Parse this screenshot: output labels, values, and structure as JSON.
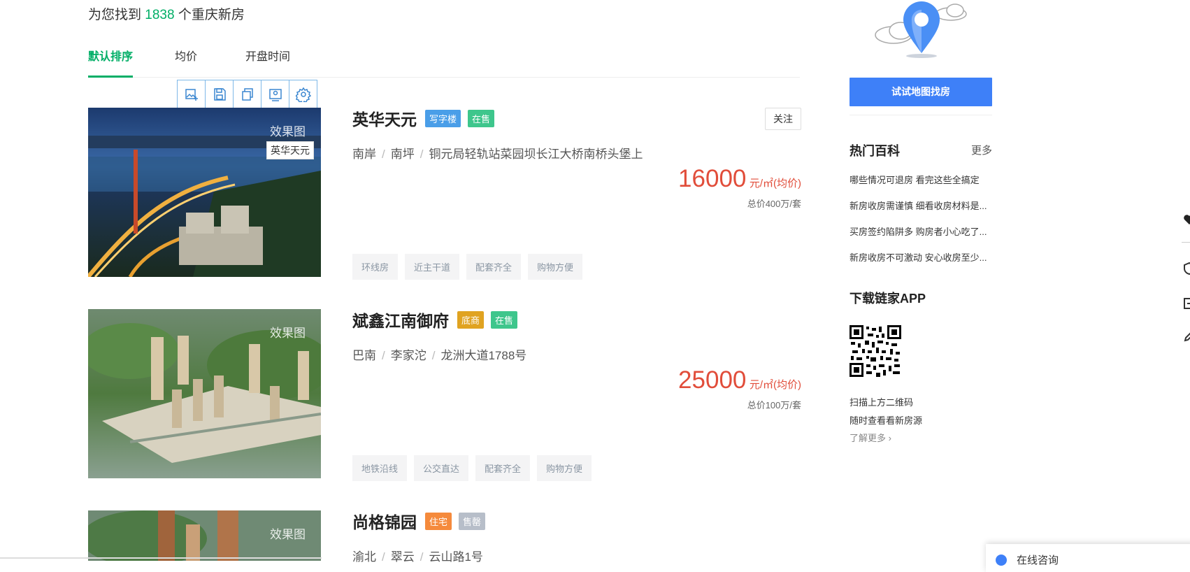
{
  "header": {
    "prefix": "为您找到",
    "count": "1838",
    "suffix": "个重庆新房"
  },
  "sort_tabs": [
    {
      "label": "默认排序",
      "active": true
    },
    {
      "label": "均价",
      "active": false
    },
    {
      "label": "开盘时间",
      "active": false
    }
  ],
  "image_toolbar": [
    "add-image-icon",
    "save-icon",
    "copy-icon",
    "image-edit-icon",
    "gear-icon"
  ],
  "listings": [
    {
      "img_label": "效果图",
      "img_name": "英华天元",
      "title": "英华天元",
      "tags": [
        {
          "text": "写字楼",
          "color": "#4a9ee8"
        },
        {
          "text": "在售",
          "color": "#3ec68c"
        }
      ],
      "follow": "关注",
      "loc": [
        "南岸",
        "南坪",
        "铜元局轻轨站菜园坝长江大桥南桥头堡上"
      ],
      "price": "16000",
      "unit": "元/㎡(均价)",
      "total": "总价400万/套",
      "features": [
        "环线房",
        "近主干道",
        "配套齐全",
        "购物方便"
      ]
    },
    {
      "img_label": "效果图",
      "title": "斌鑫江南御府",
      "tags": [
        {
          "text": "底商",
          "color": "#e0a321"
        },
        {
          "text": "在售",
          "color": "#3ec68c"
        }
      ],
      "loc": [
        "巴南",
        "李家沱",
        "龙洲大道1788号"
      ],
      "price": "25000",
      "unit": "元/㎡(均价)",
      "total": "总价100万/套",
      "features": [
        "地铁沿线",
        "公交直达",
        "配套齐全",
        "购物方便"
      ]
    },
    {
      "img_label": "效果图",
      "title": "尚格锦园",
      "tags": [
        {
          "text": "住宅",
          "color": "#f58a3c"
        },
        {
          "text": "售罄",
          "color": "#b7bec9"
        }
      ],
      "loc": [
        "渝北",
        "翠云",
        "云山路1号"
      ]
    }
  ],
  "sidebar": {
    "map_button": "试试地图找房",
    "wiki_title": "热门百科",
    "wiki_more": "更多",
    "wiki_items": [
      "哪些情况可退房 看完这些全搞定",
      "新房收房需谨慎 细看收房材料是...",
      "买房签约陷阱多 购房者小心吃了...",
      "新房收房不可激动 安心收房至少..."
    ],
    "app_title": "下载链家APP",
    "scan_lines": [
      "扫描上方二维码",
      "随时查看看新房源"
    ],
    "learn_more": "了解更多"
  },
  "side_icons": [
    "heart-icon",
    "shield-icon",
    "login-icon",
    "edit-icon"
  ],
  "chat": {
    "label": "在线咨询"
  },
  "colors": {
    "green": "#00ae66",
    "price_red": "#e14d3a",
    "blue_button": "#3e80f8"
  }
}
